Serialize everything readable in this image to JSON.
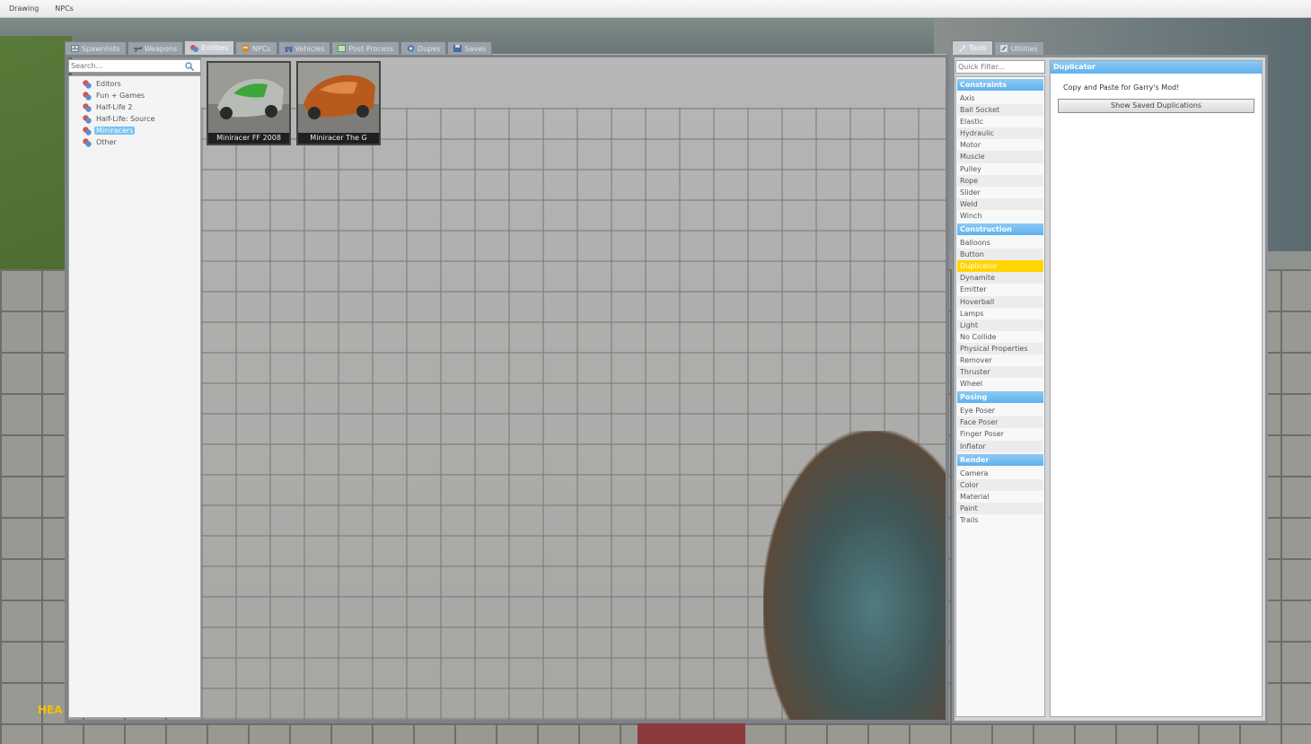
{
  "menubar": {
    "items": [
      "Drawing",
      "NPCs"
    ]
  },
  "spawnmenu": {
    "tabs": [
      {
        "label": "Spawnlists",
        "icon": "spawnlist-icon",
        "active": false
      },
      {
        "label": "Weapons",
        "icon": "weapon-icon",
        "active": false
      },
      {
        "label": "Entities",
        "icon": "entities-icon",
        "active": true
      },
      {
        "label": "NPCs",
        "icon": "npc-icon",
        "active": false
      },
      {
        "label": "Vehicles",
        "icon": "vehicle-icon",
        "active": false
      },
      {
        "label": "Post Process",
        "icon": "postprocess-icon",
        "active": false
      },
      {
        "label": "Dupes",
        "icon": "dupes-icon",
        "active": false
      },
      {
        "label": "Saves",
        "icon": "saves-icon",
        "active": false
      }
    ],
    "search": {
      "placeholder": "Search...",
      "value": ""
    },
    "categories": [
      "Editors",
      "Fun + Games",
      "Half-Life 2",
      "Half-Life: Source",
      "Miniracers",
      "Other"
    ],
    "selected_category": "Miniracers",
    "items": [
      {
        "label": "Miniracer FF 2008",
        "color": "#3ea63a"
      },
      {
        "label": "Miniracer The G",
        "color": "#b85a1e"
      }
    ]
  },
  "toolmenu": {
    "tabs": [
      {
        "label": "Tools",
        "icon": "wrench-icon",
        "active": true
      },
      {
        "label": "Utilities",
        "icon": "utilities-icon",
        "active": false
      }
    ],
    "filter": {
      "placeholder": "Quick Filter...",
      "value": ""
    },
    "categories": [
      {
        "name": "Constraints",
        "tools": [
          "Axis",
          "Ball Socket",
          "Elastic",
          "Hydraulic",
          "Motor",
          "Muscle",
          "Pulley",
          "Rope",
          "Slider",
          "Weld",
          "Winch"
        ]
      },
      {
        "name": "Construction",
        "tools": [
          "Balloons",
          "Button",
          "Duplicator",
          "Dynamite",
          "Emitter",
          "Hoverball",
          "Lamps",
          "Light",
          "No Collide",
          "Physical Properties",
          "Remover",
          "Thruster",
          "Wheel"
        ]
      },
      {
        "name": "Posing",
        "tools": [
          "Eye Poser",
          "Face Poser",
          "Finger Poser",
          "Inflator"
        ]
      },
      {
        "name": "Render",
        "tools": [
          "Camera",
          "Color",
          "Material",
          "Paint",
          "Trails"
        ]
      }
    ],
    "selected_tool": "Duplicator",
    "settings": {
      "title": "Duplicator",
      "description": "Copy and Paste for Garry's Mod!",
      "button_label": "Show Saved Duplications"
    }
  },
  "hud": {
    "text": "HEA"
  },
  "colors": {
    "accent": "#5fb1ee",
    "selected_tool": "#ffd400",
    "selected_category": "#77c2f3"
  }
}
